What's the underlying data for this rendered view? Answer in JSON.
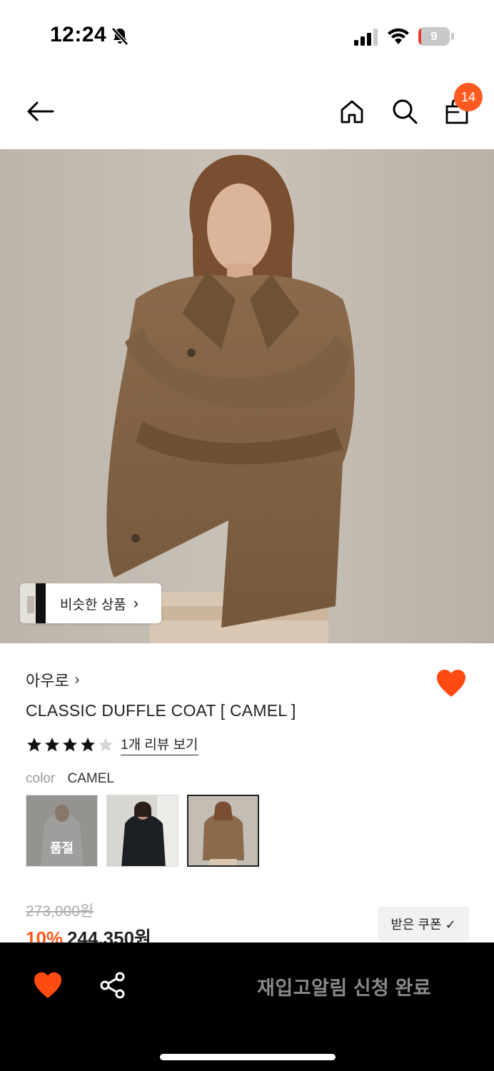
{
  "status_bar": {
    "time": "12:24",
    "battery_level": "9",
    "battery_fraction": 0.09
  },
  "nav": {
    "cart_count": "14",
    "icons": [
      "back-arrow-icon",
      "home-icon",
      "search-icon",
      "shopping-bag-icon"
    ]
  },
  "hero": {
    "similar_label": "비슷한 상품",
    "similar_chevron": "›"
  },
  "product": {
    "brand": "아우로",
    "brand_chevron": "›",
    "title": "CLASSIC DUFFLE COAT [ CAMEL ]",
    "rating": 4,
    "rating_max": 5,
    "review_link": "1개 리뷰 보기",
    "color_key": "color",
    "color_value": "CAMEL",
    "swatches": [
      {
        "label": "품절",
        "sold_out": true
      },
      {
        "label": "",
        "sold_out": false
      },
      {
        "label": "",
        "sold_out": false,
        "selected": true
      }
    ],
    "original_price": "273,000원",
    "discount": "10%",
    "final_price": "244,350원",
    "coupon_label": "받은 쿠폰 ✓"
  },
  "bottom_bar": {
    "restock_label": "재입고알림 신청 완료"
  },
  "colors": {
    "accent": "#FF5A1F",
    "bottom_bar": "#000000",
    "restock_text": "#8A8A8A"
  }
}
